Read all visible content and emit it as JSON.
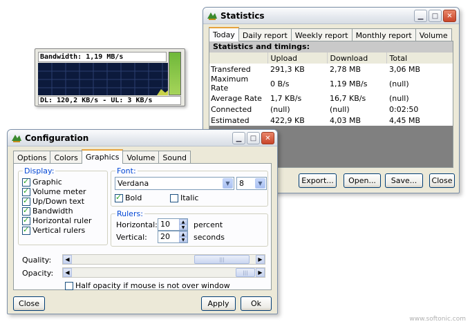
{
  "bandwidth": {
    "top_label": "Bandwidth: 1,19 MB/s",
    "bottom_label": "DL: 120,2 KB/s - UL: 3 KB/s",
    "accent_green": "#8fd14f",
    "graph_bg": "#0c1a3c"
  },
  "statistics": {
    "title": "Statistics",
    "tabs": [
      "Today",
      "Daily report",
      "Weekly report",
      "Monthly report",
      "Volume"
    ],
    "section_title": "Statistics and timings:",
    "columns": [
      "",
      "Upload",
      "Download",
      "Total"
    ],
    "rows": [
      [
        "Transfered",
        "291,3 KB",
        "2,78 MB",
        "3,06 MB"
      ],
      [
        "Maximum Rate",
        "0 B/s",
        "1,19 MB/s",
        "(null)"
      ],
      [
        "Average Rate",
        "1,7 KB/s",
        "16,7 KB/s",
        "(null)"
      ],
      [
        "Connected",
        "(null)",
        "(null)",
        "0:02:50"
      ],
      [
        "Estimated",
        "422,9 KB",
        "4,03 MB",
        "4,45 MB"
      ]
    ],
    "buttons": {
      "export": "Export...",
      "open": "Open...",
      "save": "Save...",
      "close": "Close"
    }
  },
  "configuration": {
    "title": "Configuration",
    "tabs": [
      "Options",
      "Colors",
      "Graphics",
      "Volume",
      "Sound"
    ],
    "display_legend": "Display:",
    "display_items": [
      "Graphic",
      "Volume meter",
      "Up/Down text",
      "Bandwidth",
      "Horizontal ruler",
      "Vertical rulers"
    ],
    "font_legend": "Font:",
    "font_name": "Verdana",
    "font_size": "8",
    "bold_label": "Bold",
    "bold_checked": true,
    "italic_label": "Italic",
    "italic_checked": false,
    "rulers_legend": "Rulers:",
    "horizontal_label": "Horizontal:",
    "horizontal_value": "10",
    "horizontal_unit": "percent",
    "vertical_label": "Vertical:",
    "vertical_value": "20",
    "vertical_unit": "seconds",
    "quality_label": "Quality:",
    "opacity_label": "Opacity:",
    "half_opacity_label": "Half opacity if mouse is not over window",
    "half_opacity_checked": false,
    "buttons": {
      "close": "Close",
      "apply": "Apply",
      "ok": "Ok"
    }
  },
  "watermark": "www.softonic.com"
}
